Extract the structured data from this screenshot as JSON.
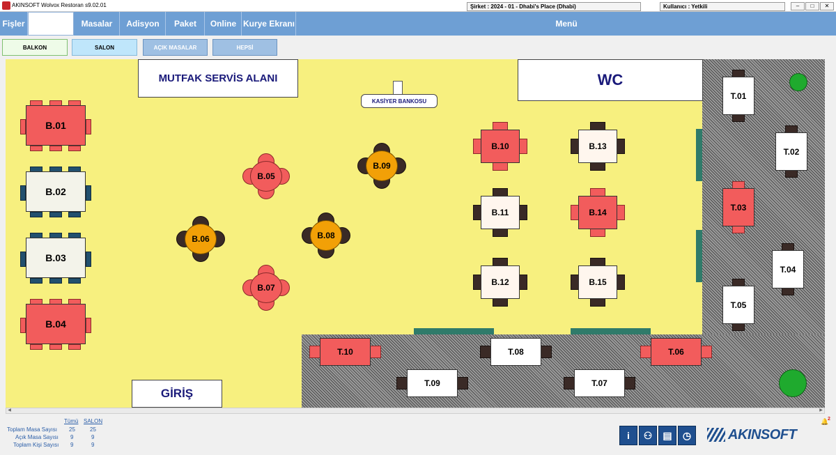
{
  "window": {
    "title": "AKINSOFT Wolvox Restoran s9.02.01",
    "company": "Şirket : 2024 - 01 - Dhabi's Place (Dhabi)",
    "user": "Kullanıcı : Yetkili"
  },
  "menu": {
    "items": [
      "Fişler",
      "Masalar",
      "Adisyon",
      "Paket",
      "Online",
      "Kurye Ekranı"
    ],
    "right_label": "Menü"
  },
  "tabs": [
    "BALKON",
    "SALON",
    "AÇIK MASALAR",
    "HEPSİ"
  ],
  "zones": {
    "kitchen": "MUTFAK SERVİS ALANI",
    "wc": "WC",
    "cashier": "KASİYER BANKOSU",
    "entrance": "GİRİŞ"
  },
  "tables": {
    "b01": "B.01",
    "b02": "B.02",
    "b03": "B.03",
    "b04": "B.04",
    "b05": "B.05",
    "b06": "B.06",
    "b07": "B.07",
    "b08": "B.08",
    "b09": "B.09",
    "b10": "B.10",
    "b11": "B.11",
    "b12": "B.12",
    "b13": "B.13",
    "b14": "B.14",
    "b15": "B.15",
    "t01": "T.01",
    "t02": "T.02",
    "t03": "T.03",
    "t04": "T.04",
    "t05": "T.05",
    "t06": "T.06",
    "t07": "T.07",
    "t08": "T.08",
    "t09": "T.09",
    "t10": "T.10"
  },
  "stats": {
    "col_all": "Tümü",
    "col_salon": "SALON",
    "rows": [
      {
        "label": "Toplam Masa Sayısı",
        "all": "25",
        "salon": "25"
      },
      {
        "label": "Açık Masa Sayısı",
        "all": "9",
        "salon": "9"
      },
      {
        "label": "Toplam Kişi Sayısı",
        "all": "9",
        "salon": "9"
      }
    ]
  },
  "notification_count": "2",
  "brand": "AKINSOFT",
  "icons": [
    "info-icon",
    "users-icon",
    "money-icon",
    "clock-icon"
  ],
  "colors": {
    "occupied": "#f25c5c",
    "free": "#ffffff",
    "reserved": "#f2a007",
    "floor": "#f7f07f",
    "menubar": "#6e9fd4"
  }
}
